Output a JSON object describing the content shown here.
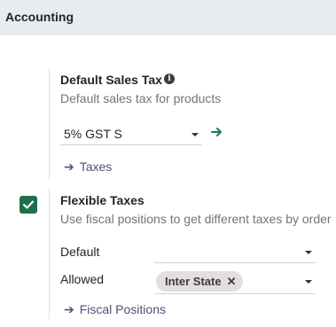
{
  "section": {
    "title": "Accounting"
  },
  "default_sales_tax": {
    "title": "Default Sales Tax",
    "info_icon": "info-icon",
    "description": "Default sales tax for products",
    "selected": "5% GST S",
    "open_icon": "arrow-right-icon",
    "link_label": "Taxes"
  },
  "flexible_taxes": {
    "checked": true,
    "title": "Flexible Taxes",
    "description": "Use fiscal positions to get different taxes by order",
    "default_label": "Default",
    "default_value": "",
    "allowed_label": "Allowed",
    "allowed_tags": [
      "Inter State"
    ],
    "link_label": "Fiscal Positions"
  },
  "colors": {
    "header_bg": "#e9ecef",
    "link": "#5c4a78",
    "checkbox": "#1f6f4a",
    "go_arrow": "#1f7a4a",
    "tag_bg": "#e4dedf"
  }
}
